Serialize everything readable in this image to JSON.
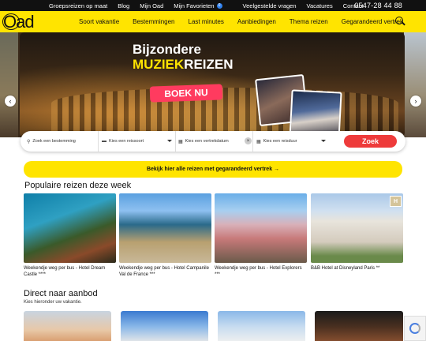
{
  "topbar": {
    "links": [
      "Groepsreizen op maat",
      "Blog",
      "Mijn Oad",
      "Mijn Favorieten",
      "Veelgestelde vragen",
      "Vacatures",
      "Contact"
    ],
    "favorites_count": "0",
    "phone": "0547-28 44 88"
  },
  "logo": {
    "text": "Oad"
  },
  "nav": {
    "items": [
      "Soort vakantie",
      "Bestemmingen",
      "Last minutes",
      "Aanbiedingen",
      "Thema reizen",
      "Gegarandeerd vertrek"
    ]
  },
  "hero": {
    "title_line1": "Bijzondere",
    "title_line2_a": "MUZIEK",
    "title_line2_b": "REIZEN",
    "cta": "BOEK NU",
    "prev": "‹",
    "next": "›"
  },
  "search": {
    "destination_placeholder": "Zoek een bestemming",
    "type_placeholder": "Kies een reissoort",
    "date_placeholder": "Kies een vertrekdatum",
    "duration_placeholder": "Kies een reisduur",
    "submit": "Zoek"
  },
  "cta_banner": "Bekijk hier alle reizen met gegarandeerd vertrek →",
  "popular": {
    "title": "Populaire reizen deze week",
    "items": [
      {
        "caption": "Weekendje weg per bus - Hotel Dream Castle ****"
      },
      {
        "caption": "Weekendje weg per bus - Hotel Campanile Val de France ***"
      },
      {
        "caption": "Weekendje weg per bus - Hotel Explorers ***"
      },
      {
        "caption": "B&B Hotel at Disneyland Paris **"
      }
    ]
  },
  "direct": {
    "title": "Direct naar aanbod",
    "subtitle": "Kies hieronder uw vakantie."
  },
  "colors": {
    "brand_yellow": "#ffe400",
    "accent_red": "#ee3b3b",
    "boek_pink": "#ff3b5f"
  }
}
